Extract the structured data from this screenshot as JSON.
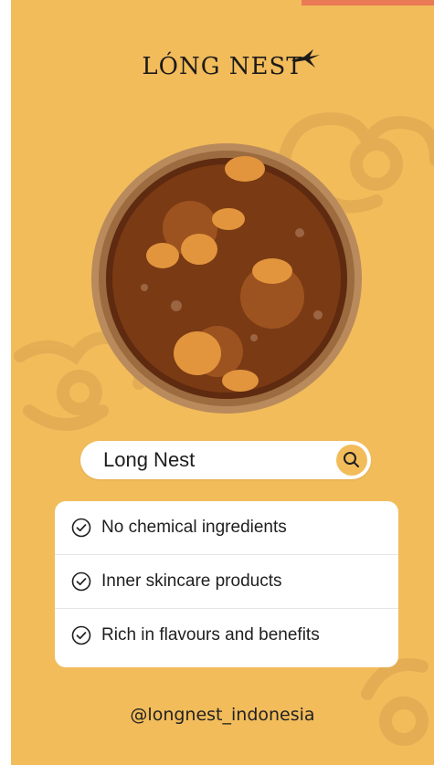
{
  "brand": {
    "name": "LÓNG NEST"
  },
  "search": {
    "query": "Long Nest"
  },
  "features": [
    {
      "label": "No chemical ingredients"
    },
    {
      "label": "Inner skincare products"
    },
    {
      "label": "Rich in flavours and benefits"
    }
  ],
  "footer": {
    "handle": "@longnest_indonesia"
  },
  "colors": {
    "background": "#f2bc5b",
    "accent_strip": "#ea7956",
    "card": "#ffffff",
    "text": "#1f1f1f"
  }
}
